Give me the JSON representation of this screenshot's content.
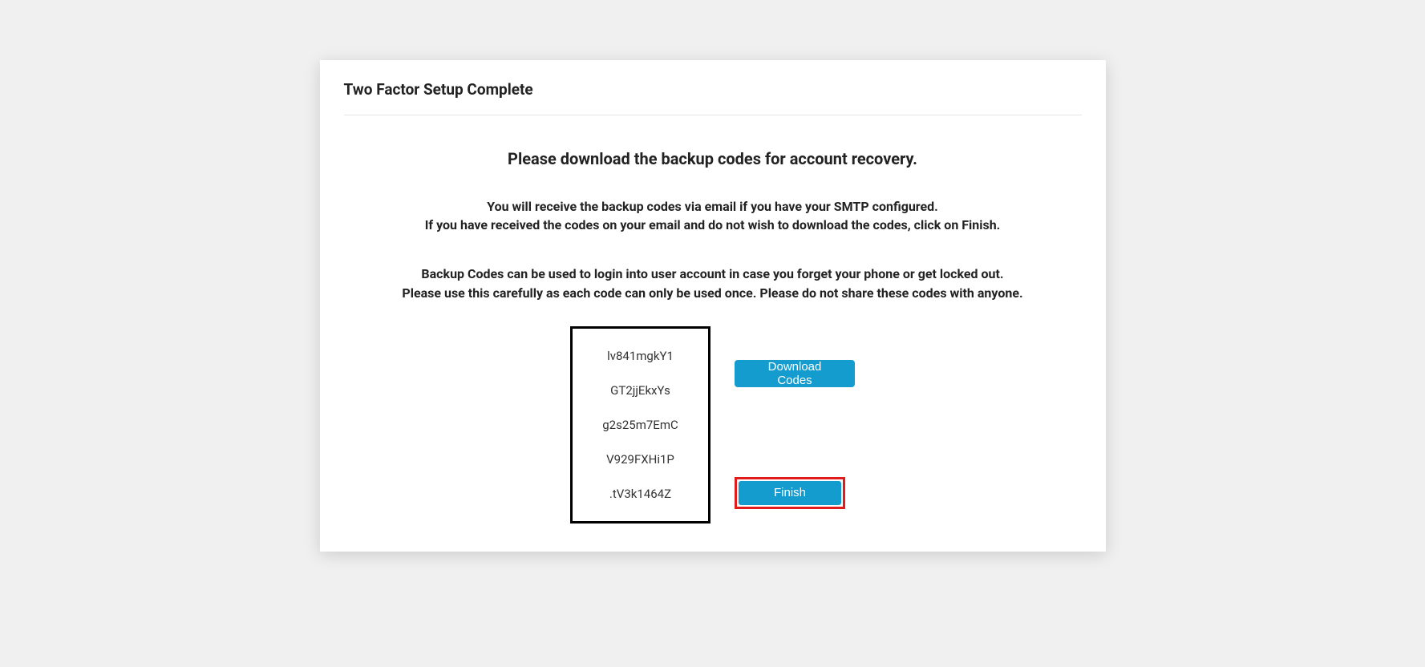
{
  "card": {
    "title": "Two Factor Setup Complete",
    "instructions_title": "Please download the backup codes for account recovery.",
    "info_line1": "You will receive the backup codes via email if you have your SMTP configured.",
    "info_line2": "If you have received the codes on your email and do not wish to download the codes, click on Finish.",
    "info_line3": "Backup Codes can be used to login into user account in case you forget your phone or get locked out.",
    "info_line4": "Please use this carefully as each code can only be used once. Please do not share these codes with anyone.",
    "codes": [
      "lv841mgkY1",
      "GT2jjEkxYs",
      "g2s25m7EmC",
      "V929FXHi1P",
      ".tV3k1464Z"
    ],
    "download_label": "Download Codes",
    "finish_label": "Finish"
  }
}
